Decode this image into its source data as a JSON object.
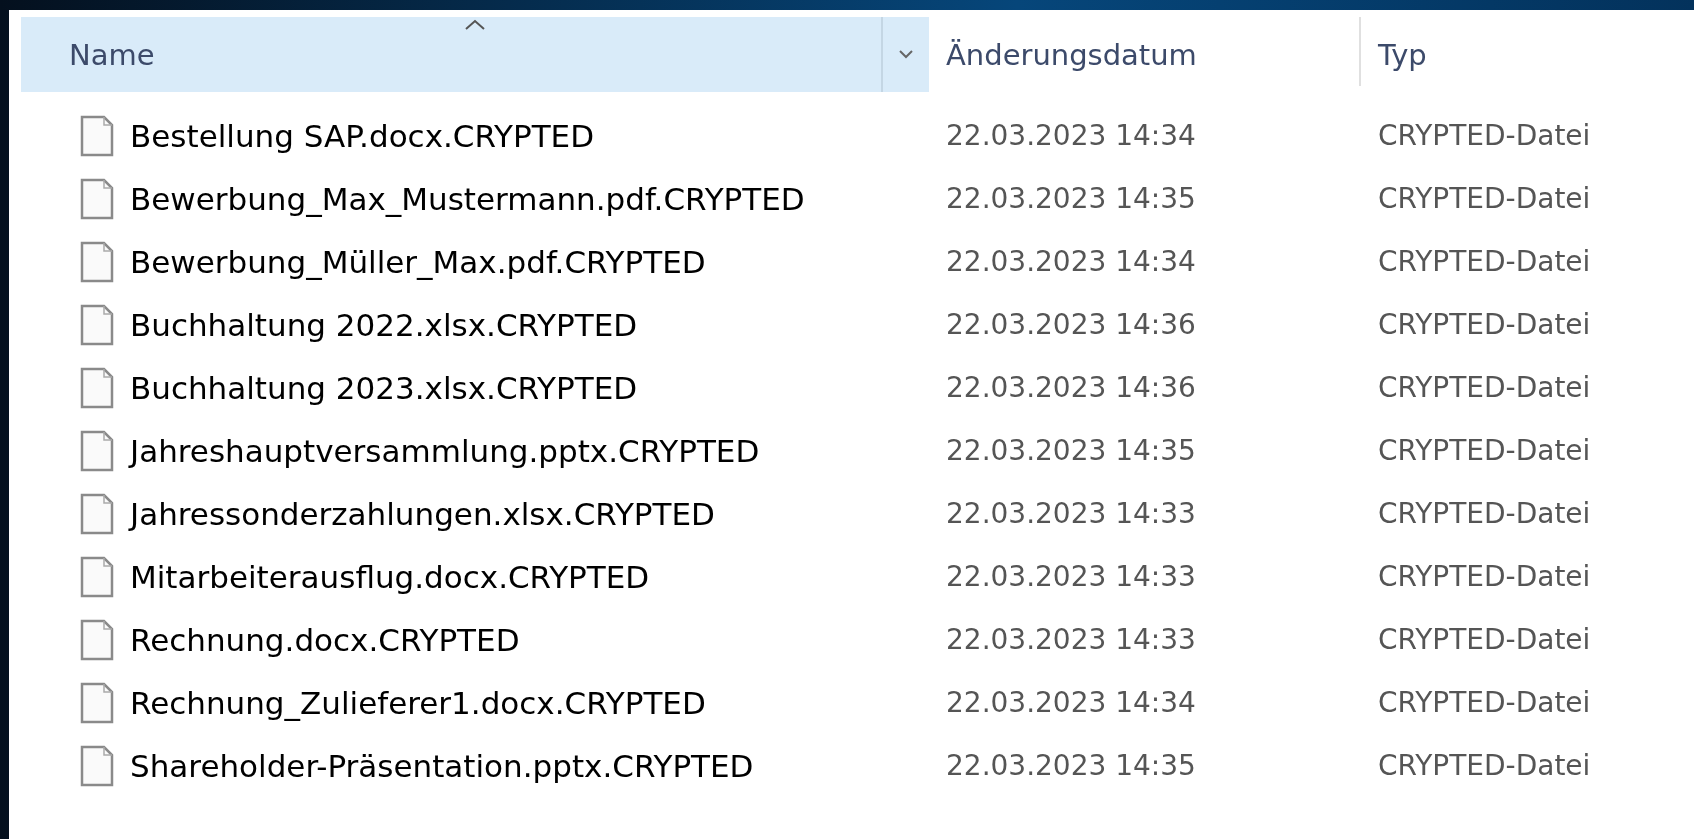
{
  "table": {
    "columns": [
      {
        "label": "Name",
        "selected": true,
        "sorted": true
      },
      {
        "label": "Änderungsdatum",
        "selected": false,
        "sorted": false
      },
      {
        "label": "Typ",
        "selected": false,
        "sorted": false
      }
    ],
    "rows": [
      {
        "name": "Bestellung SAP.docx.CRYPTED",
        "date": "22.03.2023 14:34",
        "type": "CRYPTED-Datei"
      },
      {
        "name": "Bewerbung_Max_Mustermann.pdf.CRYPTED",
        "date": "22.03.2023 14:35",
        "type": "CRYPTED-Datei"
      },
      {
        "name": "Bewerbung_Müller_Max.pdf.CRYPTED",
        "date": "22.03.2023 14:34",
        "type": "CRYPTED-Datei"
      },
      {
        "name": "Buchhaltung 2022.xlsx.CRYPTED",
        "date": "22.03.2023 14:36",
        "type": "CRYPTED-Datei"
      },
      {
        "name": "Buchhaltung 2023.xlsx.CRYPTED",
        "date": "22.03.2023 14:36",
        "type": "CRYPTED-Datei"
      },
      {
        "name": "Jahreshauptversammlung.pptx.CRYPTED",
        "date": "22.03.2023 14:35",
        "type": "CRYPTED-Datei"
      },
      {
        "name": "Jahressonderzahlungen.xlsx.CRYPTED",
        "date": "22.03.2023 14:33",
        "type": "CRYPTED-Datei"
      },
      {
        "name": "Mitarbeiterausflug.docx.CRYPTED",
        "date": "22.03.2023 14:33",
        "type": "CRYPTED-Datei"
      },
      {
        "name": "Rechnung.docx.CRYPTED",
        "date": "22.03.2023 14:33",
        "type": "CRYPTED-Datei"
      },
      {
        "name": "Rechnung_Zulieferer1.docx.CRYPTED",
        "date": "22.03.2023 14:34",
        "type": "CRYPTED-Datei"
      },
      {
        "name": "Shareholder-Präsentation.pptx.CRYPTED",
        "date": "22.03.2023 14:35",
        "type": "CRYPTED-Datei"
      }
    ]
  }
}
